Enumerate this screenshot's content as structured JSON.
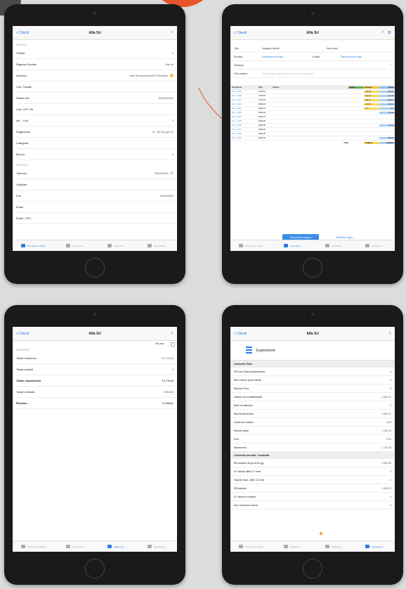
{
  "colors": {
    "accent": "#2a7ae2",
    "orange": "#e8542a",
    "green": "#7fbf6e",
    "yellow": "#f7d75a",
    "blue": "#a8cff2"
  },
  "nav": {
    "back": "< Clienti",
    "title": "Alfa Srl"
  },
  "tabs": [
    "Informazioni cliente",
    "Documenti",
    "Pagamenti",
    "Esposizione"
  ],
  "info": {
    "section1": "Modulo",
    "rows": [
      {
        "label": "Cliente",
        "value": "0"
      },
      {
        "label": "Ragione Sociale",
        "value": "Alfa Srl"
      },
      {
        "label": "Indirizzo",
        "value": "Viale Risorgimento 6/3/2 Monticello"
      },
      {
        "label": "Cod. Fiscale",
        "value": ""
      },
      {
        "label": "Partita IVA",
        "value": "00000000000"
      },
      {
        "label": "Cod. UFF. PA",
        "value": ""
      },
      {
        "label": "Att. - Cod.",
        "value": "0"
      },
      {
        "label": "Pagamento",
        "value": "01 - 60 GG pgm fm"
      },
      {
        "label": "Categoria",
        "value": ""
      },
      {
        "label": "Blocco",
        "value": "0"
      }
    ],
    "section2": "Contatti",
    "rows2": [
      {
        "label": "Telefono",
        "value": "0000000000"
      },
      {
        "label": "Cellulare",
        "value": ""
      },
      {
        "label": "Fax",
        "value": "0000000000"
      },
      {
        "label": "Email",
        "value": ""
      },
      {
        "label": "Email - PEC",
        "value": ""
      }
    ]
  },
  "docs": {
    "filters": [
      {
        "label": "Tipo",
        "value": "Impegno cliente",
        "extra": "Non evasi"
      },
      {
        "label": "Da data",
        "value": "Seleziona una data",
        "extra_label": "A data",
        "extra": "Seleziona una data"
      },
      {
        "label": "Destinaz.",
        "value": "",
        "extra": ""
      },
      {
        "label": "Filtro esteso",
        "value": "Filtri per tipo documento, numero di documento",
        "extra": ""
      }
    ],
    "headers": [
      "Documento",
      "Data",
      "Cliente /",
      "Evaso",
      "Inevaso",
      "Totale"
    ],
    "rows": [
      [
        "Imp. cl. 326",
        "26/02/20",
        "",
        "",
        "106,00",
        "106,00"
      ],
      [
        "Imp. cl. 325",
        "27/02/20",
        "",
        "",
        "317,00",
        "317,00"
      ],
      [
        "Imp. cl. 324",
        "27/02/20",
        "",
        "",
        "953,11",
        "953,11"
      ],
      [
        "Imp. cl. 323",
        "28/02/20",
        "",
        "",
        "213,00",
        "213,00"
      ],
      [
        "Imp. cl. 322",
        "28/02/20",
        "",
        "",
        "0,0",
        "0,0"
      ],
      [
        "Imp. cl. 321",
        "28/01/20",
        "",
        "",
        "",
        "94,44"
      ],
      [
        "Imp. cl. 320",
        "28/01/20",
        "",
        "",
        "",
        ""
      ],
      [
        "Imp. cl. 319",
        "28/01/20",
        "",
        "",
        "",
        ""
      ],
      [
        "Imp. cl. 318",
        "28/01/20",
        "",
        "",
        "",
        "94,44"
      ],
      [
        "Imp. cl. 317",
        "28/01/20",
        "",
        "",
        "",
        ""
      ],
      [
        "Imp. cl. 316",
        "28/01/20",
        "",
        "",
        "",
        ""
      ],
      [
        "Imp. cl. 315",
        "28/01/20",
        "",
        "",
        "",
        "394,84"
      ]
    ],
    "total_label": "Totali",
    "totals": [
      "",
      "2.588,84",
      "2.685,22"
    ],
    "btn_primary": "Documento singolo",
    "btn_link": "Visualizza righe"
  },
  "payments": {
    "paid_label": "Solo imp.",
    "section": "Scadenze",
    "rows": [
      {
        "label": "Totale scadenze",
        "value": "€ 2.712,64",
        "bold": false
      },
      {
        "label": "Totale insoluti",
        "value": "0",
        "bold": false
      },
      {
        "label": "Totale esposizione",
        "value": "€ 2.712,64",
        "bold": true
      },
      {
        "label": "Totale ordinato",
        "value": "€ 553,84",
        "bold": false
      },
      {
        "label": "Residuo",
        "value": "€ 2.085,61",
        "bold": true
      }
    ]
  },
  "exposure": {
    "title": "Esposizione",
    "sec1": "Controllo Fido",
    "rows1": [
      {
        "label": "RB Con Data Autorizzazione",
        "value": "0"
      },
      {
        "label": "RB a rischio (solo clienti)",
        "value": "0"
      },
      {
        "label": "Rischio Primo",
        "value": "0"
      },
      {
        "label": "Fatture non contabilizzate",
        "value": "1.962,01"
      },
      {
        "label": "Bolle da fatturare",
        "value": "0"
      },
      {
        "label": "Rischio finanziario",
        "value": "1.962,01"
      },
      {
        "label": "Ordini da evadere",
        "value": "0,00"
      },
      {
        "label": "Rischio totale",
        "value": "1.115,35"
      },
      {
        "label": "Fido",
        "value": "0,00"
      },
      {
        "label": "Sforamento",
        "value": "1.115,35"
      }
    ],
    "sec2": "Controllo insoluti / ricalibati",
    "rows2": [
      {
        "label": "RB scadute da più di 30 gg",
        "value": "2.454,53"
      },
      {
        "label": "N° insoluti ultimi 12 mesi",
        "value": "0"
      },
      {
        "label": "Importo insol. ultimi 12 mesi",
        "value": "0"
      },
      {
        "label": "RB scadute",
        "value": "2.454,53"
      },
      {
        "label": "N° insoluti in essere",
        "value": "0"
      },
      {
        "label": "Imp. insoluti in essere",
        "value": "0"
      }
    ]
  }
}
